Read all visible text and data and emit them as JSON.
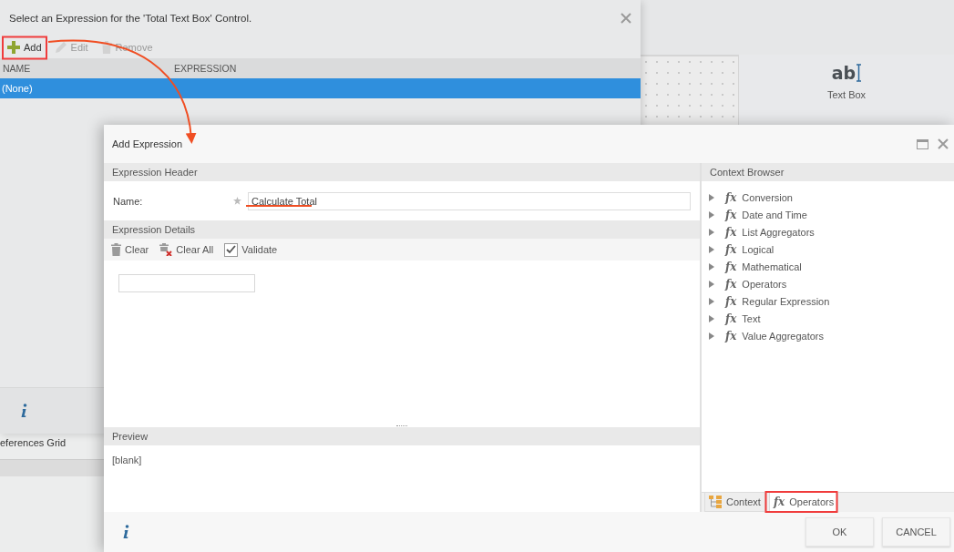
{
  "background_dialog": {
    "title": "Select an Expression for the 'Total Text Box' Control.",
    "toolbar": [
      {
        "label": "Add",
        "kind": "add",
        "disabled": false
      },
      {
        "label": "Edit",
        "kind": "edit",
        "disabled": true
      },
      {
        "label": "Remove",
        "kind": "remove",
        "disabled": true
      }
    ],
    "columns": [
      "NAME",
      "EXPRESSION"
    ],
    "rows": [
      {
        "name": "(None)",
        "selected": true
      }
    ]
  },
  "toolbox": {
    "icon_text": "ab",
    "label": "Text Box"
  },
  "references": {
    "label": "eferences Grid"
  },
  "dialog": {
    "title": "Add Expression",
    "expression_header": {
      "title": "Expression Header",
      "fields": [
        {
          "label": "Name:",
          "required": true,
          "value": "Calculate Total"
        }
      ]
    },
    "expression_details": {
      "title": "Expression Details",
      "toolbar": [
        {
          "label": "Clear",
          "kind": "clear"
        },
        {
          "label": "Clear All",
          "kind": "clear-all"
        },
        {
          "label": "Validate",
          "kind": "validate",
          "checked": true
        }
      ]
    },
    "preview": {
      "title": "Preview",
      "text": "[blank]"
    },
    "context_browser": {
      "title": "Context Browser",
      "items": [
        {
          "label": "Conversion",
          "symbol": "fx",
          "expanded": false
        },
        {
          "label": "Date and Time",
          "symbol": "fx",
          "expanded": false
        },
        {
          "label": "List Aggregators",
          "symbol": "fx",
          "expanded": false
        },
        {
          "label": "Logical",
          "symbol": "fx",
          "expanded": false
        },
        {
          "label": "Mathematical",
          "symbol": "fx",
          "expanded": false
        },
        {
          "label": "Operators",
          "symbol": "fx",
          "expanded": false
        },
        {
          "label": "Regular Expression",
          "symbol": "fx",
          "expanded": false
        },
        {
          "label": "Text",
          "symbol": "fx",
          "expanded": false
        },
        {
          "label": "Value Aggregators",
          "symbol": "fx",
          "expanded": false
        }
      ]
    },
    "tabs": [
      {
        "label": "Context",
        "kind": "context",
        "selected": false
      },
      {
        "label": "Operators",
        "kind": "functions",
        "symbol": "fx",
        "selected": true
      }
    ],
    "buttons": [
      "OK",
      "CANCEL"
    ]
  }
}
